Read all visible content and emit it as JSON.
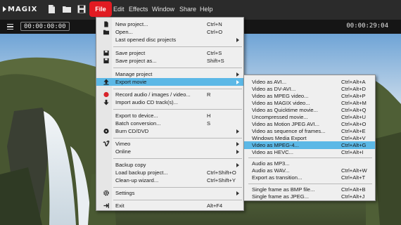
{
  "app": {
    "logo": "MAGIX"
  },
  "menubar": {
    "items": [
      "File",
      "Edit",
      "Effects",
      "Window",
      "Share",
      "Help"
    ],
    "active": "File",
    "accent": "#e11b22"
  },
  "transport": {
    "timecode_left": "00:00:00:00",
    "timecode_right": "00:00:29:04"
  },
  "file_menu": {
    "items": [
      {
        "label": "New project...",
        "shortcut": "Ctrl+N",
        "icon": "new-document-icon"
      },
      {
        "label": "Open...",
        "shortcut": "Ctrl+O",
        "icon": "open-folder-icon"
      },
      {
        "label": "Last opened disc projects",
        "shortcut": "",
        "submenu": true
      },
      {
        "label": "Save project",
        "shortcut": "Ctrl+S",
        "icon": "save-icon"
      },
      {
        "label": "Save project as...",
        "shortcut": "Shift+S",
        "icon": "save-as-icon"
      },
      {
        "label": "Manage project",
        "shortcut": "",
        "submenu": true
      },
      {
        "label": "Export movie",
        "shortcut": "",
        "submenu": true,
        "icon": "export-icon",
        "highlighted": true
      },
      {
        "label": "Record audio / images / video...",
        "shortcut": "R",
        "icon": "record-icon"
      },
      {
        "label": "Import audio CD track(s)...",
        "shortcut": "",
        "icon": "import-icon"
      },
      {
        "label": "Export to device...",
        "shortcut": "H"
      },
      {
        "label": "Batch conversion...",
        "shortcut": "S"
      },
      {
        "label": "Burn CD/DVD",
        "shortcut": "",
        "submenu": true,
        "icon": "disc-icon"
      },
      {
        "label": "Vimeo",
        "shortcut": "",
        "submenu": true,
        "icon": "vimeo-icon"
      },
      {
        "label": "Online",
        "shortcut": "",
        "submenu": true
      },
      {
        "label": "Backup copy",
        "shortcut": "",
        "submenu": true
      },
      {
        "label": "Load backup project...",
        "shortcut": "Ctrl+Shift+O"
      },
      {
        "label": "Clean-up wizard...",
        "shortcut": "Ctrl+Shift+Y"
      },
      {
        "label": "Settings",
        "shortcut": "",
        "submenu": true,
        "icon": "gear-icon"
      },
      {
        "label": "Exit",
        "shortcut": "Alt+F4",
        "icon": "exit-icon"
      }
    ]
  },
  "export_submenu": {
    "items": [
      {
        "label": "Video as AVI...",
        "shortcut": "Ctrl+Alt+A"
      },
      {
        "label": "Video as DV-AVI...",
        "shortcut": "Ctrl+Alt+D"
      },
      {
        "label": "Video as MPEG video...",
        "shortcut": "Ctrl+Alt+P"
      },
      {
        "label": "Video as MAGIX video...",
        "shortcut": "Ctrl+Alt+M"
      },
      {
        "label": "Video as Quicktime movie...",
        "shortcut": "Ctrl+Alt+Q"
      },
      {
        "label": "Uncompressed movie...",
        "shortcut": "Ctrl+Alt+U"
      },
      {
        "label": "Video as Motion JPEG AVI...",
        "shortcut": "Ctrl+Alt+O"
      },
      {
        "label": "Video as sequence of frames...",
        "shortcut": "Ctrl+Alt+E"
      },
      {
        "label": "Windows Media Export",
        "shortcut": "Ctrl+Alt+V"
      },
      {
        "label": "Video as MPEG-4...",
        "shortcut": "Ctrl+Alt+G",
        "highlighted": true
      },
      {
        "label": "Video as HEVC...",
        "shortcut": "Ctrl+Alt+I"
      },
      {
        "label": "Audio as MP3...",
        "shortcut": ""
      },
      {
        "label": "Audio as WAV...",
        "shortcut": "Ctrl+Alt+W"
      },
      {
        "label": "Export as transition...",
        "shortcut": "Ctrl+Alt+T"
      },
      {
        "label": "Single frame as BMP file...",
        "shortcut": "Ctrl+Alt+B"
      },
      {
        "label": "Single frame as JPEG...",
        "shortcut": "Ctrl+Alt+J"
      }
    ]
  },
  "colors": {
    "highlight": "#5cb8e6",
    "menu_bg": "#efefef",
    "menubar_bg": "#2b2b2b"
  }
}
